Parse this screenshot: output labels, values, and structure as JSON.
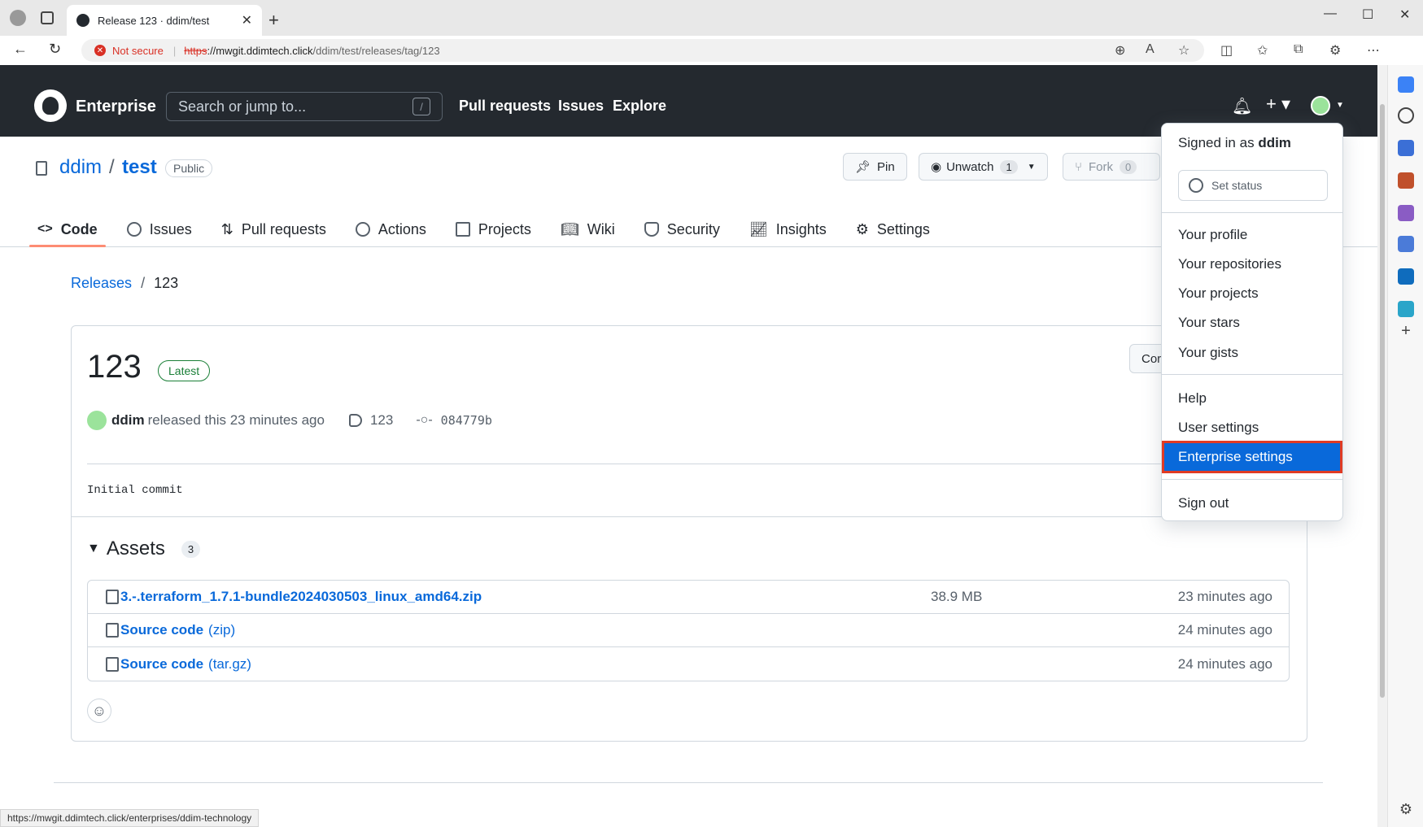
{
  "browser": {
    "tab_title": "Release 123 · ddim/test",
    "not_secure": "Not secure",
    "url_https": "https",
    "url_host": "://mwgit.ddimtech.click",
    "url_path": "/ddim/test/releases/tag/123",
    "status_url": "https://mwgit.ddimtech.click/enterprises/ddim-technology"
  },
  "header": {
    "brand": "Enterprise",
    "search_placeholder": "Search or jump to...",
    "search_key": "/",
    "nav": [
      "Pull requests",
      "Issues",
      "Explore"
    ]
  },
  "repo": {
    "owner": "ddim",
    "name": "test",
    "visibility": "Public",
    "pin_label": "Pin",
    "unwatch_label": "Unwatch",
    "unwatch_count": "1",
    "fork_label": "Fork",
    "fork_count": "0",
    "tabs": [
      "Code",
      "Issues",
      "Pull requests",
      "Actions",
      "Projects",
      "Wiki",
      "Security",
      "Insights",
      "Settings"
    ]
  },
  "breadcrumb": {
    "releases": "Releases",
    "current": "123"
  },
  "release": {
    "title": "123",
    "latest_label": "Latest",
    "compare_label": "Cor",
    "author": "ddim",
    "released_text": "released this 23 minutes ago",
    "tag": "123",
    "commit": "084779b",
    "body": "Initial commit",
    "assets_label": "Assets",
    "assets_count": "3",
    "assets": [
      {
        "name": "3.-.terraform_1.7.1-bundle2024030503_linux_amd64.zip",
        "suffix": "",
        "size": "38.9 MB",
        "time": "23 minutes ago"
      },
      {
        "name": "Source code",
        "suffix": "(zip)",
        "size": "",
        "time": "24 minutes ago"
      },
      {
        "name": "Source code",
        "suffix": "(tar.gz)",
        "size": "",
        "time": "24 minutes ago"
      }
    ]
  },
  "dropdown": {
    "signed_in_as": "Signed in as",
    "username": "ddim",
    "set_status": "Set status",
    "items1": [
      "Your profile",
      "Your repositories",
      "Your projects",
      "Your stars",
      "Your gists"
    ],
    "items2": [
      "Help",
      "User settings",
      "Enterprise settings"
    ],
    "sign_out": "Sign out"
  },
  "colors": {
    "header_bg": "#24292f",
    "link": "#0969da",
    "highlight": "#0969da",
    "highlight_border": "#e03b24",
    "latest": "#1a7f37"
  }
}
